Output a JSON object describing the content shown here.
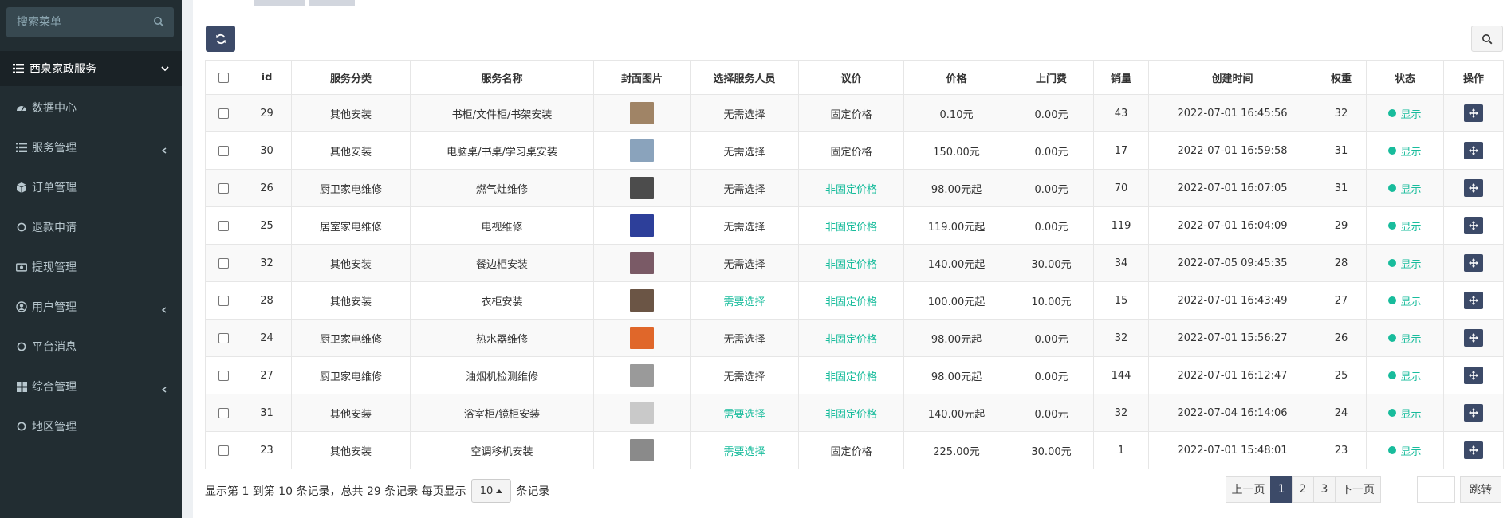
{
  "sidebar": {
    "search_placeholder": "搜索菜单",
    "group_title": "西泉家政服务",
    "items": [
      {
        "label": "数据中心",
        "icon": "dashboard-icon",
        "arrow": false
      },
      {
        "label": "服务管理",
        "icon": "list-icon",
        "arrow": true
      },
      {
        "label": "订单管理",
        "icon": "cube-icon",
        "arrow": false
      },
      {
        "label": "退款申请",
        "icon": "circle-icon",
        "arrow": false
      },
      {
        "label": "提现管理",
        "icon": "money-icon",
        "arrow": false
      },
      {
        "label": "用户管理",
        "icon": "user-icon",
        "arrow": true
      },
      {
        "label": "平台消息",
        "icon": "circle-icon",
        "arrow": false
      },
      {
        "label": "综合管理",
        "icon": "grid-icon",
        "arrow": true
      },
      {
        "label": "地区管理",
        "icon": "circle-icon",
        "arrow": false
      }
    ]
  },
  "table": {
    "headers": [
      "id",
      "服务分类",
      "服务名称",
      "封面图片",
      "选择服务人员",
      "议价",
      "价格",
      "上门费",
      "销量",
      "创建时间",
      "权重",
      "状态",
      "操作"
    ],
    "rows": [
      {
        "id": "29",
        "category": "其他安装",
        "name": "书柜/文件柜/书架安装",
        "thumb_color": "#a08466",
        "staff": "无需选择",
        "staff_green": false,
        "bargain": "固定价格",
        "bargain_green": false,
        "price": "0.10元",
        "fee": "0.00元",
        "sales": "43",
        "created": "2022-07-01 16:45:56",
        "weight": "32",
        "status": "显示"
      },
      {
        "id": "30",
        "category": "其他安装",
        "name": "电脑桌/书桌/学习桌安装",
        "thumb_color": "#8aa3bc",
        "staff": "无需选择",
        "staff_green": false,
        "bargain": "固定价格",
        "bargain_green": false,
        "price": "150.00元",
        "fee": "0.00元",
        "sales": "17",
        "created": "2022-07-01 16:59:58",
        "weight": "31",
        "status": "显示"
      },
      {
        "id": "26",
        "category": "厨卫家电维修",
        "name": "燃气灶维修",
        "thumb_color": "#4c4c4c",
        "staff": "无需选择",
        "staff_green": false,
        "bargain": "非固定价格",
        "bargain_green": true,
        "price": "98.00元起",
        "fee": "0.00元",
        "sales": "70",
        "created": "2022-07-01 16:07:05",
        "weight": "31",
        "status": "显示"
      },
      {
        "id": "25",
        "category": "居室家电维修",
        "name": "电视维修",
        "thumb_color": "#2d3f9a",
        "staff": "无需选择",
        "staff_green": false,
        "bargain": "非固定价格",
        "bargain_green": true,
        "price": "119.00元起",
        "fee": "0.00元",
        "sales": "119",
        "created": "2022-07-01 16:04:09",
        "weight": "29",
        "status": "显示"
      },
      {
        "id": "32",
        "category": "其他安装",
        "name": "餐边柜安装",
        "thumb_color": "#7a5a66",
        "staff": "无需选择",
        "staff_green": false,
        "bargain": "非固定价格",
        "bargain_green": true,
        "price": "140.00元起",
        "fee": "30.00元",
        "sales": "34",
        "created": "2022-07-05 09:45:35",
        "weight": "28",
        "status": "显示"
      },
      {
        "id": "28",
        "category": "其他安装",
        "name": "衣柜安装",
        "thumb_color": "#6b5545",
        "staff": "需要选择",
        "staff_green": true,
        "bargain": "非固定价格",
        "bargain_green": true,
        "price": "100.00元起",
        "fee": "10.00元",
        "sales": "15",
        "created": "2022-07-01 16:43:49",
        "weight": "27",
        "status": "显示"
      },
      {
        "id": "24",
        "category": "厨卫家电维修",
        "name": "热水器维修",
        "thumb_color": "#e0672a",
        "staff": "无需选择",
        "staff_green": false,
        "bargain": "非固定价格",
        "bargain_green": true,
        "price": "98.00元起",
        "fee": "0.00元",
        "sales": "32",
        "created": "2022-07-01 15:56:27",
        "weight": "26",
        "status": "显示"
      },
      {
        "id": "27",
        "category": "厨卫家电维修",
        "name": "油烟机检测维修",
        "thumb_color": "#9a9a9a",
        "staff": "无需选择",
        "staff_green": false,
        "bargain": "非固定价格",
        "bargain_green": true,
        "price": "98.00元起",
        "fee": "0.00元",
        "sales": "144",
        "created": "2022-07-01 16:12:47",
        "weight": "25",
        "status": "显示"
      },
      {
        "id": "31",
        "category": "其他安装",
        "name": "浴室柜/镜柜安装",
        "thumb_color": "#c9c9c9",
        "staff": "需要选择",
        "staff_green": true,
        "bargain": "非固定价格",
        "bargain_green": true,
        "price": "140.00元起",
        "fee": "0.00元",
        "sales": "32",
        "created": "2022-07-04 16:14:06",
        "weight": "24",
        "status": "显示"
      },
      {
        "id": "23",
        "category": "其他安装",
        "name": "空调移机安装",
        "thumb_color": "#8a8a8a",
        "staff": "需要选择",
        "staff_green": true,
        "bargain": "固定价格",
        "bargain_green": false,
        "price": "225.00元",
        "fee": "30.00元",
        "sales": "1",
        "created": "2022-07-01 15:48:01",
        "weight": "23",
        "status": "显示"
      }
    ]
  },
  "footer": {
    "info_prefix": "显示第 1 到第 10 条记录，总共 29 条记录 每页显示",
    "page_size": "10",
    "info_suffix": "条记录",
    "prev": "上一页",
    "pages": [
      "1",
      "2",
      "3"
    ],
    "active_page": "1",
    "next": "下一页",
    "jump": "跳转"
  },
  "colors": {
    "sidebar_bg": "#222d32",
    "primary_btn": "#3c4a68",
    "status_green": "#18bc9c"
  }
}
